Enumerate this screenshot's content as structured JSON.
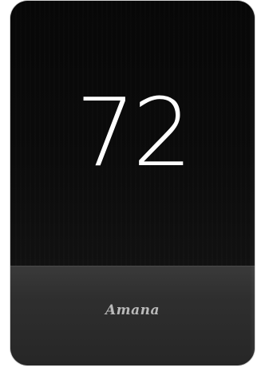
{
  "thermostat": {
    "temperature": "72",
    "brand": "Amana"
  }
}
